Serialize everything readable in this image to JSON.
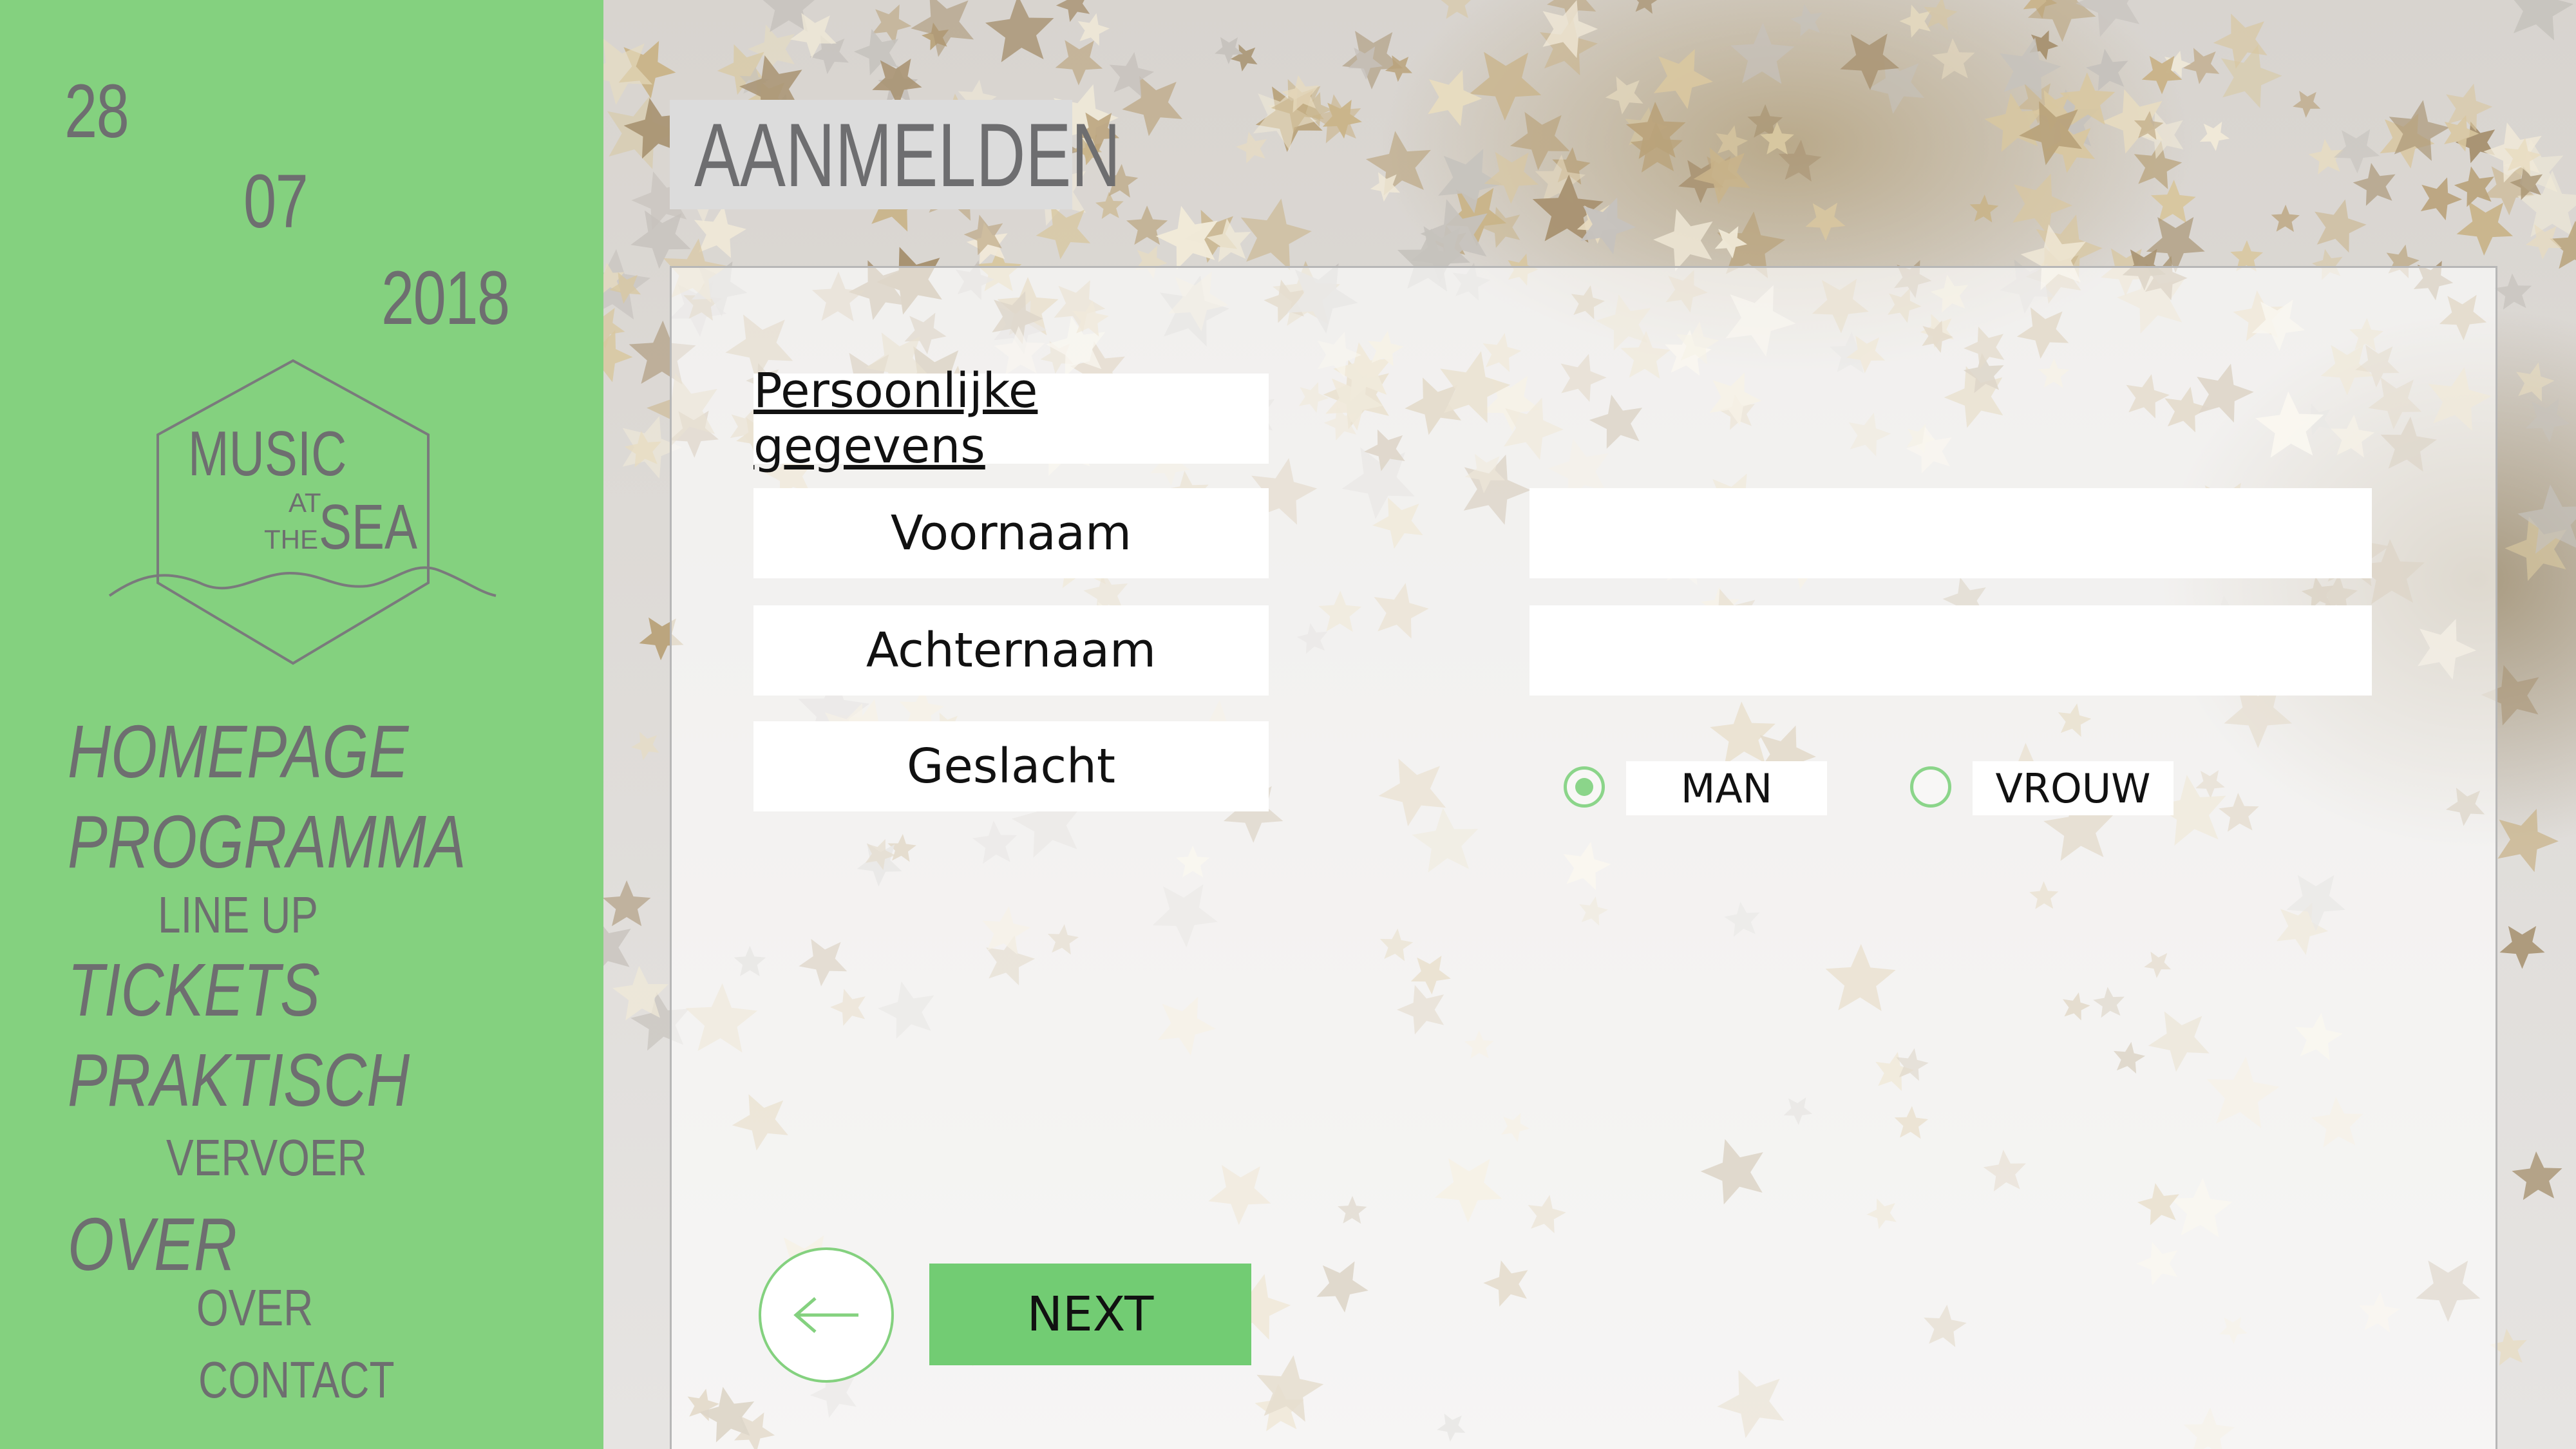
{
  "date": {
    "day": "28",
    "month": "07",
    "year": "2018"
  },
  "logo": {
    "line1": "MUSIC",
    "line2": "AT",
    "line3": "THE",
    "line4": "SEA"
  },
  "nav": [
    {
      "label": "HOMEPAGE",
      "level": "main"
    },
    {
      "label": "PROGRAMMA",
      "level": "main"
    },
    {
      "label": "LINE UP",
      "level": "sub"
    },
    {
      "label": "TICKETS",
      "level": "main"
    },
    {
      "label": "PRAKTISCH",
      "level": "main"
    },
    {
      "label": "VERVOER",
      "level": "sub"
    },
    {
      "label": "OVER",
      "level": "main"
    },
    {
      "label": "OVER",
      "level": "sub"
    },
    {
      "label": "CONTACT",
      "level": "sub"
    }
  ],
  "page": {
    "title": "AANMELDEN"
  },
  "form": {
    "section_label": "Persoonlijke gegevens",
    "fields": [
      {
        "label": "Voornaam",
        "value": ""
      },
      {
        "label": "Achternaam",
        "value": ""
      },
      {
        "label": "Geslacht"
      }
    ],
    "gender_options": [
      {
        "label": "MAN",
        "selected": true
      },
      {
        "label": "VROUW",
        "selected": false
      }
    ],
    "next_label": "NEXT",
    "back_icon": "arrow-left-icon"
  },
  "colors": {
    "sidebar": "#84d17f",
    "accent": "#72cc73",
    "text_grey": "#6e6e70"
  }
}
